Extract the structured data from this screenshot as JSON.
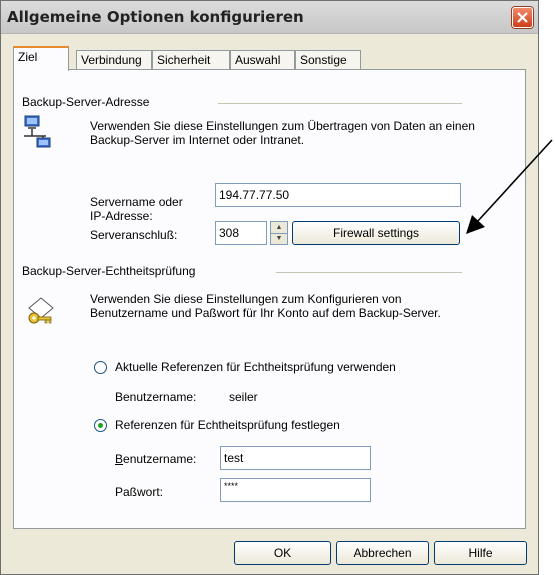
{
  "window": {
    "title": "Allgemeine Optionen konfigurieren"
  },
  "tabs": [
    {
      "label": "Ziel"
    },
    {
      "label": "Verbindung"
    },
    {
      "label": "Sicherheit"
    },
    {
      "label": "Auswahl"
    },
    {
      "label": "Sonstige"
    }
  ],
  "backup_server": {
    "group_title": "Backup-Server-Adresse",
    "description": "Verwenden Sie diese Einstellungen zum Übertragen von Daten an einen Backup-Server im Internet oder Intranet.",
    "servername_label_line1": "Servername oder",
    "servername_label_line2": "IP-Adresse:",
    "servername_value": "194.77.77.50",
    "port_label": "Serveranschluß:",
    "port_value": "308",
    "firewall_button": "Firewall settings"
  },
  "auth": {
    "group_title": "Backup-Server-Echtheitsprüfung",
    "description": "Verwenden Sie diese Einstellungen zum Konfigurieren von Benutzername und Paßwort für Ihr Konto auf dem Backup-Server.",
    "option_current": "Aktuelle Referenzen für Echtheitsprüfung verwenden",
    "current_user_label": "Benutzername:",
    "current_user_value": "seiler",
    "option_custom": "Referenzen für Echtheitsprüfung festlegen",
    "user_label_underlined": "B",
    "user_label_rest": "enutzername:",
    "user_value": "test",
    "password_label": "Paßwort:",
    "password_value": "****"
  },
  "buttons": {
    "ok": "OK",
    "cancel": "Abbrechen",
    "help": "Hilfe"
  }
}
